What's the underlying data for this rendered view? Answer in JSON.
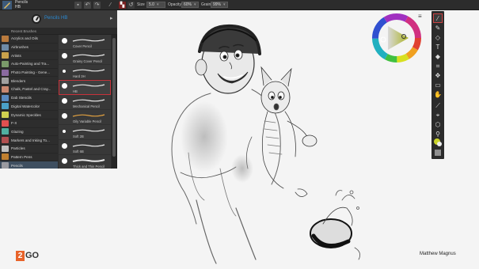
{
  "topbar": {
    "brush_category": "Pencils",
    "brush_variant": "HB",
    "size_label": "Size",
    "size_value": "5.0",
    "opacity_label": "Opacity",
    "opacity_value": "60%",
    "grain_label": "Grain",
    "grain_value": "99%"
  },
  "brush_panel": {
    "selected_name": "Pencils HB",
    "recent_label": "Recent Brushes",
    "categories": [
      {
        "label": "Acrylics and Oils",
        "color": "#b97a3d"
      },
      {
        "label": "Airbrushes",
        "color": "#6f8ba6"
      },
      {
        "label": "Artists",
        "color": "#c9a24b"
      },
      {
        "label": "Auto-Painting and Tra...",
        "color": "#7a9a6a"
      },
      {
        "label": "Photo Painting - Gene...",
        "color": "#8a6aa0"
      },
      {
        "label": "Blenders",
        "color": "#a0a0a0"
      },
      {
        "label": "Chalk, Pastel and Cray...",
        "color": "#c98870"
      },
      {
        "label": "Dab Stencils",
        "color": "#5a8ac0"
      },
      {
        "label": "Digital Watercolor",
        "color": "#4aa0c8"
      },
      {
        "label": "Dynamic Speckles",
        "color": "#d0d050"
      },
      {
        "label": "F-X",
        "color": "#e05050"
      },
      {
        "label": "Glazing",
        "color": "#50b0a0"
      },
      {
        "label": "Markers and Inking To...",
        "color": "#b05050"
      },
      {
        "label": "Particles",
        "color": "#c0c0c0"
      },
      {
        "label": "Pattern Pens",
        "color": "#c08030"
      },
      {
        "label": "Pencils",
        "color": "#9a9aa0"
      },
      {
        "label": "Pens",
        "color": "#8080a0"
      }
    ],
    "variants": [
      {
        "label": "Cover Pencil"
      },
      {
        "label": "Grainy Cover Pencil"
      },
      {
        "label": "Hard 3H"
      },
      {
        "label": "HB"
      },
      {
        "label": "Mechanical Pencil"
      },
      {
        "label": "Oily Variable Pencil"
      },
      {
        "label": "Soft 2B"
      },
      {
        "label": "Soft 6B"
      },
      {
        "label": "Thick and Thin Pencil"
      }
    ]
  },
  "toolbox": {
    "tools": [
      "brush-tool",
      "dropper-tool",
      "paint-bucket-tool",
      "text-tool",
      "eraser-tool",
      "crop-tool",
      "transform-tool",
      "selection-tool",
      "lasso-tool",
      "magic-wand-tool",
      "clone-tool",
      "shape-tool",
      "magnifier-tool",
      "hand-tool",
      "color-swatch",
      "paper-swatch"
    ]
  },
  "colors": {
    "accent_red": "#c8323a",
    "panel_bg": "#2d2d2d",
    "logo_orange": "#e8632a"
  },
  "watermark": {
    "logo_number": "2",
    "logo_text": "GO",
    "artist_credit": "Matthew Magnus"
  }
}
